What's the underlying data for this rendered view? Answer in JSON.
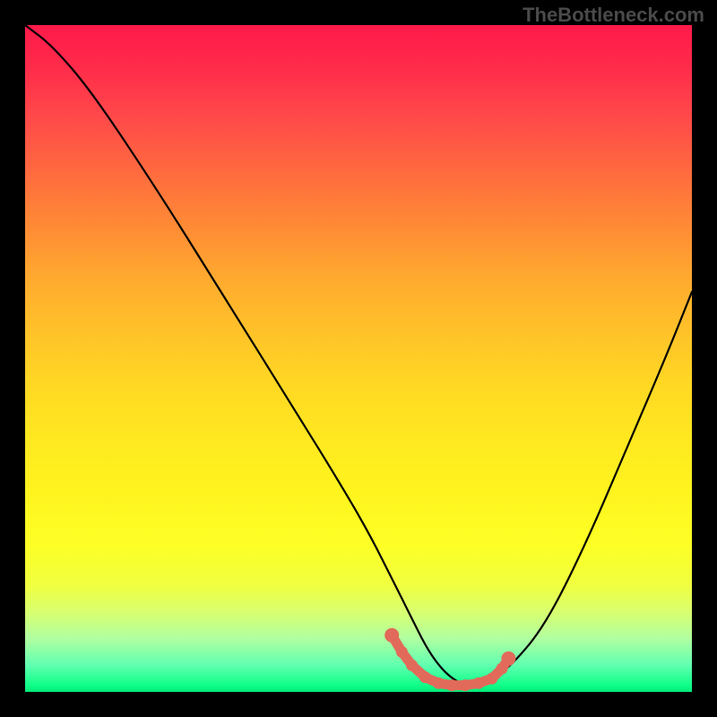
{
  "watermark": "TheBottleneck.com",
  "chart_data": {
    "type": "line",
    "title": "",
    "xlabel": "",
    "ylabel": "",
    "xlim": [
      0,
      100
    ],
    "ylim": [
      0,
      100
    ],
    "grid": false,
    "legend": false,
    "note": "Axes are unlabeled in the source; x/y are normalized 0–100 read from pixel positions.",
    "series": [
      {
        "name": "bottleneck-curve",
        "color": "#000000",
        "x": [
          0,
          4,
          10,
          20,
          30,
          40,
          48,
          52,
          55,
          58,
          60,
          62,
          64,
          66,
          68,
          70,
          73,
          78,
          84,
          90,
          96,
          100
        ],
        "y": [
          100,
          97,
          90,
          75,
          59,
          43,
          30,
          23,
          17,
          11,
          7,
          4,
          2,
          1,
          1,
          2,
          4,
          10,
          22,
          36,
          50,
          60
        ]
      }
    ],
    "markers": {
      "name": "highlight-region",
      "color": "#e26a5a",
      "x": [
        55.0,
        56.5,
        58.0,
        60.0,
        62.0,
        64.0,
        66.0,
        68.0,
        70.0,
        71.5,
        72.5
      ],
      "y": [
        8.5,
        6.0,
        4.0,
        2.2,
        1.3,
        1.0,
        1.0,
        1.3,
        2.0,
        3.5,
        5.0
      ]
    }
  }
}
